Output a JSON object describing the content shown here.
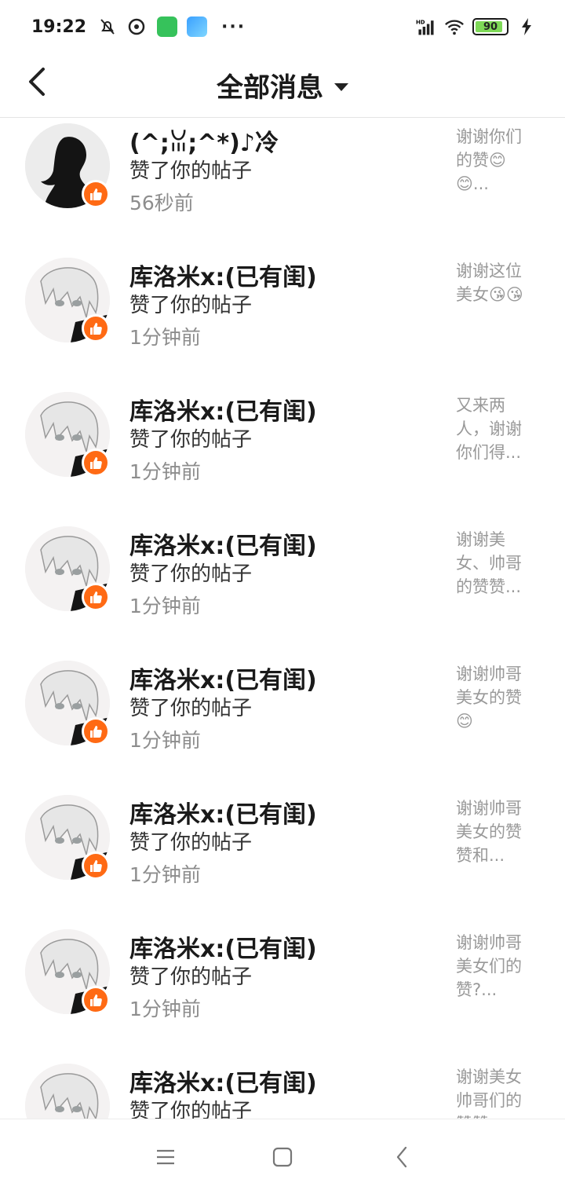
{
  "status_bar": {
    "time": "19:22",
    "battery": "90",
    "icons": [
      "mute-bell-icon",
      "media-icon",
      "app-icon-green",
      "app-icon-blue",
      "more-dots",
      "hd-signal-icon",
      "wifi-icon",
      "battery-icon",
      "charging-icon"
    ],
    "more": "···"
  },
  "header": {
    "title": "全部消息",
    "back_icon": "chevron-left-icon",
    "dropdown_icon": "caret-down-icon"
  },
  "notifications": [
    {
      "name": "(^;ꈍ;^*)♪冷",
      "action": "赞了你的帖子",
      "time": "56秒前",
      "preview": "谢谢你们的赞😊😊..."
    },
    {
      "name": "库洛米x:(已有闺)",
      "action": "赞了你的帖子",
      "time": "1分钟前",
      "preview": "谢谢这位美女😘😘"
    },
    {
      "name": "库洛米x:(已有闺)",
      "action": "赞了你的帖子",
      "time": "1分钟前",
      "preview": "又来两人，谢谢你们得..."
    },
    {
      "name": "库洛米x:(已有闺)",
      "action": "赞了你的帖子",
      "time": "1分钟前",
      "preview": "谢谢美女、帅哥的赞赞..."
    },
    {
      "name": "库洛米x:(已有闺)",
      "action": "赞了你的帖子",
      "time": "1分钟前",
      "preview": "谢谢帅哥美女的赞😊"
    },
    {
      "name": "库洛米x:(已有闺)",
      "action": "赞了你的帖子",
      "time": "1分钟前",
      "preview": "谢谢帅哥美女的赞赞和..."
    },
    {
      "name": "库洛米x:(已有闺)",
      "action": "赞了你的帖子",
      "time": "1分钟前",
      "preview": "谢谢帅哥美女们的赞?..."
    },
    {
      "name": "库洛米x:(已有闺)",
      "action": "赞了你的帖子",
      "time": "",
      "preview": "谢谢美女帅哥们的赞赞"
    }
  ],
  "colors": {
    "accent": "#ff6a14",
    "muted": "#8d8d8d"
  },
  "nav_bar": {
    "icons": [
      "menu-icon",
      "home-square-icon",
      "back-icon"
    ]
  }
}
